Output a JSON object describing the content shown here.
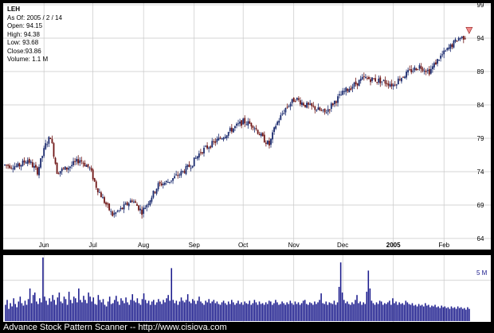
{
  "chart_data": {
    "type": "candlestick",
    "symbol": "LEH",
    "info": {
      "as_of": "As Of: 2005 / 2 / 14",
      "open": "Open: 94.15",
      "high": "High: 94.38",
      "low": "Low: 93.68",
      "close": "Close:93.86",
      "volume": "Volume: 1.1 M"
    },
    "y_ticks": [
      "99",
      "94",
      "89",
      "84",
      "79",
      "74",
      "69",
      "64"
    ],
    "ylim": [
      64,
      99
    ],
    "x_labels": [
      {
        "label": "Jun",
        "day": 24,
        "bold": false
      },
      {
        "label": "Jul",
        "day": 54,
        "bold": false
      },
      {
        "label": "Aug",
        "day": 85,
        "bold": false
      },
      {
        "label": "Sep",
        "day": 116,
        "bold": false
      },
      {
        "label": "Oct",
        "day": 146,
        "bold": false
      },
      {
        "label": "Nov",
        "day": 177,
        "bold": false
      },
      {
        "label": "Dec",
        "day": 207,
        "bold": false
      },
      {
        "label": "2005",
        "day": 238,
        "bold": true
      },
      {
        "label": "Feb",
        "day": 269,
        "bold": false
      }
    ],
    "day_range": [
      0,
      285
    ],
    "volume_tick_label": "5 M",
    "volume_max": 8,
    "volume_tick": 5,
    "anchors": [
      [
        0,
        75.0
      ],
      [
        8,
        74.8
      ],
      [
        14,
        75.8
      ],
      [
        20,
        74.0
      ],
      [
        25,
        78.0
      ],
      [
        28,
        79.3
      ],
      [
        32,
        74.0
      ],
      [
        38,
        74.5
      ],
      [
        46,
        75.8
      ],
      [
        52,
        74.5
      ],
      [
        56,
        71.8
      ],
      [
        61,
        69.5
      ],
      [
        66,
        67.5
      ],
      [
        72,
        68.5
      ],
      [
        78,
        69.8
      ],
      [
        84,
        68.0
      ],
      [
        88,
        69.5
      ],
      [
        94,
        72.0
      ],
      [
        100,
        72.5
      ],
      [
        108,
        73.8
      ],
      [
        114,
        75.0
      ],
      [
        120,
        77.0
      ],
      [
        126,
        78.0
      ],
      [
        132,
        79.0
      ],
      [
        140,
        80.5
      ],
      [
        146,
        81.5
      ],
      [
        152,
        81.0
      ],
      [
        158,
        79.0
      ],
      [
        162,
        78.0
      ],
      [
        166,
        81.0
      ],
      [
        172,
        83.5
      ],
      [
        178,
        85.0
      ],
      [
        184,
        84.0
      ],
      [
        190,
        83.5
      ],
      [
        196,
        82.8
      ],
      [
        202,
        84.5
      ],
      [
        208,
        86.0
      ],
      [
        214,
        87.0
      ],
      [
        220,
        88.0
      ],
      [
        226,
        87.8
      ],
      [
        232,
        87.5
      ],
      [
        238,
        87.0
      ],
      [
        242,
        88.0
      ],
      [
        248,
        89.0
      ],
      [
        254,
        89.8
      ],
      [
        260,
        89.0
      ],
      [
        266,
        91.0
      ],
      [
        272,
        92.5
      ],
      [
        278,
        94.0
      ],
      [
        282,
        94.2
      ]
    ],
    "volume_values": [
      2.0,
      2.6,
      1.5,
      2.2,
      1.8,
      2.8,
      2.1,
      1.7,
      2.4,
      3.0,
      2.2,
      1.9,
      2.5,
      2.0,
      2.7,
      4.0,
      2.2,
      3.2,
      3.5,
      2.4,
      2.1,
      2.8,
      2.3,
      7.8,
      3.0,
      2.5,
      2.0,
      2.8,
      2.4,
      3.2,
      2.6,
      2.0,
      2.9,
      3.5,
      2.4,
      2.2,
      3.0,
      2.7,
      2.0,
      3.6,
      2.6,
      2.2,
      3.0,
      2.8,
      2.3,
      4.0,
      2.6,
      2.3,
      3.1,
      2.6,
      2.2,
      3.5,
      3.0,
      2.4,
      2.9,
      2.1,
      2.0,
      3.2,
      2.6,
      2.3,
      2.7,
      2.0,
      1.8,
      2.4,
      3.0,
      2.1,
      2.2,
      2.6,
      3.1,
      2.4,
      2.0,
      2.8,
      2.5,
      2.2,
      2.9,
      2.3,
      2.0,
      2.6,
      3.3,
      2.5,
      2.3,
      2.8,
      2.2,
      2.0,
      2.7,
      3.4,
      2.6,
      2.2,
      2.5,
      2.0,
      2.4,
      2.6,
      2.0,
      2.3,
      2.7,
      2.4,
      2.1,
      2.6,
      2.3,
      2.8,
      3.2,
      2.5,
      6.5,
      2.6,
      2.2,
      2.5,
      2.0,
      2.4,
      2.9,
      2.5,
      2.3,
      2.6,
      3.3,
      2.4,
      2.2,
      2.7,
      2.5,
      2.1,
      2.5,
      3.0,
      2.4,
      2.2,
      2.0,
      2.5,
      2.3,
      2.7,
      2.2,
      2.4,
      2.6,
      2.2,
      2.4,
      2.1,
      2.0,
      2.3,
      2.5,
      2.2,
      2.0,
      2.4,
      2.1,
      2.6,
      2.3,
      2.0,
      2.2,
      2.5,
      2.1,
      2.3,
      2.0,
      2.4,
      2.2,
      2.1,
      2.5,
      2.0,
      2.2,
      2.6,
      2.3,
      2.0,
      2.4,
      2.1,
      2.2,
      2.0,
      2.3,
      2.1,
      2.5,
      2.4,
      2.0,
      2.2,
      2.6,
      2.3,
      2.0,
      2.1,
      2.4,
      2.2,
      2.0,
      2.3,
      2.1,
      2.5,
      2.2,
      2.0,
      2.4,
      2.1,
      2.3,
      2.0,
      2.2,
      2.5,
      2.6,
      2.1,
      2.0,
      2.3,
      2.2,
      2.0,
      2.4,
      2.1,
      2.3,
      2.6,
      3.4,
      2.2,
      2.1,
      2.4,
      2.0,
      2.3,
      2.2,
      2.1,
      2.5,
      2.0,
      2.3,
      4.2,
      7.2,
      3.5,
      2.6,
      2.2,
      2.4,
      2.1,
      2.0,
      2.3,
      2.1,
      2.6,
      3.2,
      2.2,
      2.4,
      2.0,
      2.3,
      2.1,
      3.6,
      6.2,
      4.0,
      2.5,
      2.2,
      2.0,
      2.3,
      2.1,
      2.5,
      2.4,
      2.0,
      2.2,
      2.1,
      2.3,
      2.5,
      2.0,
      2.8,
      2.2,
      2.4,
      2.0,
      2.3,
      2.1,
      2.2,
      2.0,
      2.5,
      2.3,
      2.1,
      2.0,
      2.2,
      1.9,
      2.0,
      1.8,
      2.1,
      1.9,
      2.0,
      1.8,
      2.2,
      1.9,
      2.0,
      1.7,
      1.9,
      1.8,
      2.0,
      1.7,
      1.8,
      1.6,
      1.9,
      1.7,
      1.8,
      1.6,
      1.7,
      1.5,
      1.8,
      1.6,
      1.7,
      1.5,
      1.8,
      1.6,
      1.7,
      1.5,
      1.6,
      1.4,
      1.7,
      1.5
    ],
    "colors": {
      "background": "#000000",
      "panel": "#ffffff",
      "grid": "#c8c8c8",
      "up": "#1a2a6e",
      "down": "#6e1414",
      "volume": "#1a1a8c",
      "marker": "#f08a8a"
    }
  },
  "footer": {
    "text": "Advance Stock Pattern Scanner -- http://www.cisiova.com"
  }
}
